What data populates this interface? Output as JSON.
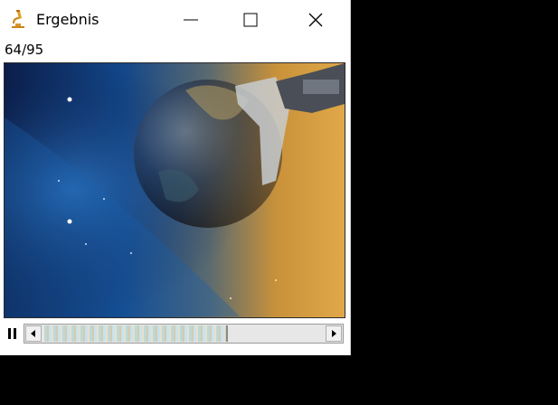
{
  "window": {
    "title": "Ergebnis",
    "controls": [
      "minimize",
      "maximize",
      "close"
    ]
  },
  "frame_counter": "64/95",
  "playback": {
    "state": "paused-control-shown",
    "position_fraction": 0.66
  },
  "icons": {
    "app": "microscope-icon",
    "pause": "pause-icon",
    "left_arrow": "arrow-left-icon",
    "right_arrow": "arrow-right-icon"
  },
  "colors": {
    "window_bg": "#ffffff",
    "desktop_bg": "#000000",
    "accent_icon": "#e0a020"
  }
}
